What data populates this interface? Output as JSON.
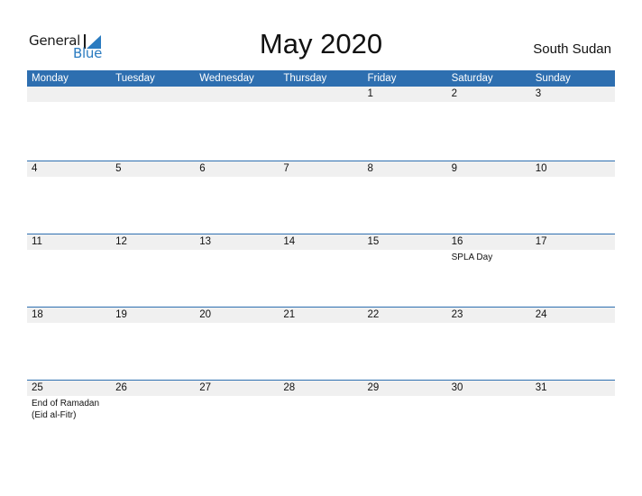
{
  "logo": {
    "line1": "General",
    "line2": "Blue"
  },
  "title": "May 2020",
  "country": "South Sudan",
  "colors": {
    "accent": "#2e6fb0",
    "day_bar": "#f0f0f0",
    "logo_blue": "#2a7bc0"
  },
  "weekdays": [
    "Monday",
    "Tuesday",
    "Wednesday",
    "Thursday",
    "Friday",
    "Saturday",
    "Sunday"
  ],
  "weeks": [
    {
      "days": [
        "",
        "",
        "",
        "",
        "1",
        "2",
        "3"
      ],
      "events": [
        "",
        "",
        "",
        "",
        "",
        "",
        ""
      ]
    },
    {
      "days": [
        "4",
        "5",
        "6",
        "7",
        "8",
        "9",
        "10"
      ],
      "events": [
        "",
        "",
        "",
        "",
        "",
        "",
        ""
      ]
    },
    {
      "days": [
        "11",
        "12",
        "13",
        "14",
        "15",
        "16",
        "17"
      ],
      "events": [
        "",
        "",
        "",
        "",
        "",
        "SPLA Day",
        ""
      ]
    },
    {
      "days": [
        "18",
        "19",
        "20",
        "21",
        "22",
        "23",
        "24"
      ],
      "events": [
        "",
        "",
        "",
        "",
        "",
        "",
        ""
      ]
    },
    {
      "days": [
        "25",
        "26",
        "27",
        "28",
        "29",
        "30",
        "31"
      ],
      "events": [
        "End of Ramadan (Eid al-Fitr)",
        "",
        "",
        "",
        "",
        "",
        ""
      ]
    }
  ]
}
